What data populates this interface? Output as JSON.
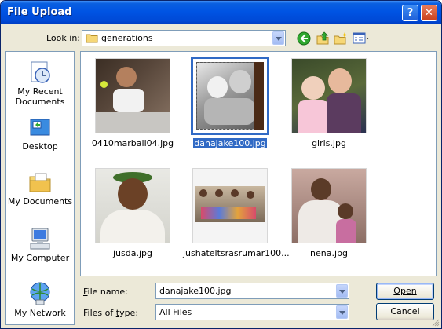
{
  "window": {
    "title": "File Upload"
  },
  "toolbar": {
    "look_in_label": "Look in:",
    "look_in_value": "generations"
  },
  "places": [
    {
      "label": "My Recent Documents",
      "icon": "recent-documents-icon"
    },
    {
      "label": "Desktop",
      "icon": "desktop-icon"
    },
    {
      "label": "My Documents",
      "icon": "my-documents-icon"
    },
    {
      "label": "My Computer",
      "icon": "my-computer-icon"
    },
    {
      "label": "My Network",
      "icon": "my-network-icon"
    }
  ],
  "files": [
    {
      "name": "0410marball04.jpg",
      "selected": false
    },
    {
      "name": "danajake100.jpg",
      "selected": true
    },
    {
      "name": "girls.jpg",
      "selected": false
    },
    {
      "name": "jusda.jpg",
      "selected": false
    },
    {
      "name": "jushateltsrasrumar100...",
      "selected": false
    },
    {
      "name": "nena.jpg",
      "selected": false
    }
  ],
  "form": {
    "file_name_label": "File name:",
    "file_name_value": "danajake100.jpg",
    "file_type_label": "Files of type:",
    "file_type_value": "All Files"
  },
  "buttons": {
    "open": "Open",
    "cancel": "Cancel"
  },
  "colors": {
    "title_bar": "#0054e3",
    "selection": "#316ac5",
    "dialog_bg": "#ece9d8"
  }
}
